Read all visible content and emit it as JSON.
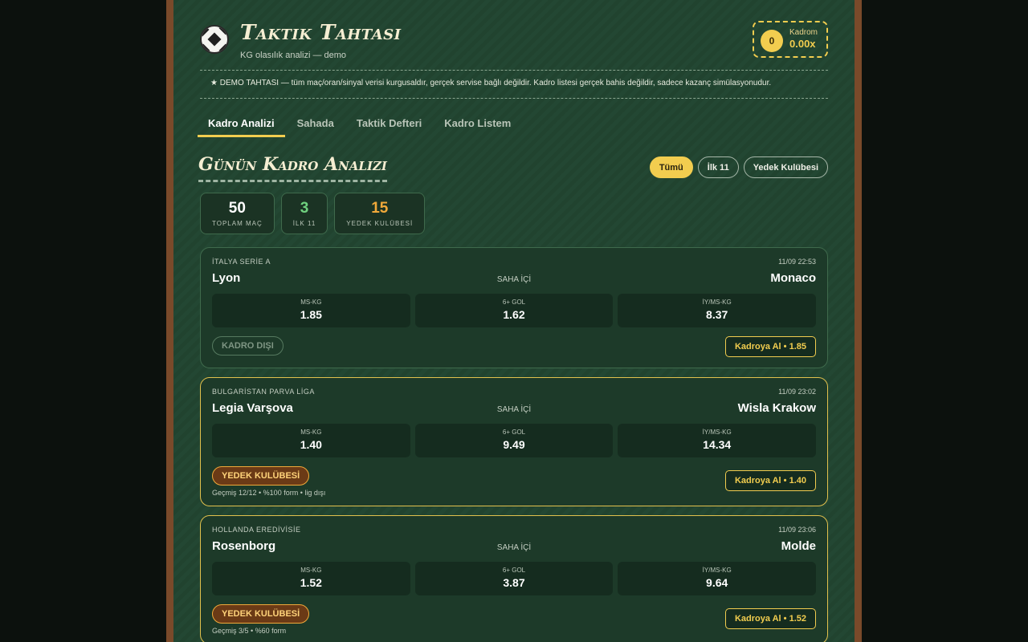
{
  "app": {
    "title": "Taktik Tahtası",
    "subtitle": "KG olasılık analizi — demo"
  },
  "wallet": {
    "count": "0",
    "label": "Kadrom",
    "value": "0.00x"
  },
  "demo_note": "★ DEMO TAHTASI — tüm maç/oran/sinyal verisi kurgusaldır, gerçek servise bağlı değildir. Kadro listesi gerçek bahis değildir, sadece kazanç simülasyonudur.",
  "tabs": [
    {
      "label": "Kadro Analizi",
      "active": true
    },
    {
      "label": "Sahada",
      "active": false
    },
    {
      "label": "Taktik Defteri",
      "active": false
    },
    {
      "label": "Kadro Listem",
      "active": false
    }
  ],
  "section": {
    "title": "Günün Kadro Analizi"
  },
  "filters": [
    {
      "label": "Tümü",
      "active": true
    },
    {
      "label": "İlk 11",
      "active": false
    },
    {
      "label": "Yedek Kulübesi",
      "active": false
    }
  ],
  "stats": [
    {
      "value": "50",
      "label": "TOPLAM MAÇ",
      "color": "#ffffff"
    },
    {
      "value": "3",
      "label": "İLK 11",
      "color": "#6fd17f"
    },
    {
      "value": "15",
      "label": "YEDEK KULÜBESİ",
      "color": "#f0a93a"
    }
  ],
  "colors": {
    "accent": "#f2cd4f",
    "board": "#21432f",
    "frame": "#7a4a2a"
  },
  "matches": [
    {
      "league": "İTALYA SERİE A",
      "time": "11/09 22:53",
      "home": "Lyon",
      "away": "Monaco",
      "status": "SAHA İÇİ",
      "odds": [
        {
          "label": "MS-KG",
          "value": "1.85"
        },
        {
          "label": "6+ GOL",
          "value": "1.62"
        },
        {
          "label": "İY/MS-KG",
          "value": "8.37"
        }
      ],
      "badge": "KADRO DIŞI",
      "badge_type": "out",
      "form": "",
      "add_label": "Kadroya Al • 1.85"
    },
    {
      "league": "BULGARİSTAN PARVA LİGA",
      "time": "11/09 23:02",
      "home": "Legia Varşova",
      "away": "Wisla Krakow",
      "status": "SAHA İÇİ",
      "odds": [
        {
          "label": "MS-KG",
          "value": "1.40"
        },
        {
          "label": "6+ GOL",
          "value": "9.49"
        },
        {
          "label": "İY/MS-KG",
          "value": "14.34"
        }
      ],
      "badge": "YEDEK KULÜBESİ",
      "badge_type": "bench",
      "form": "Geçmiş 12/12 • %100 form • lig dışı",
      "add_label": "Kadroya Al • 1.40"
    },
    {
      "league": "HOLLANDA EREDİVİSİE",
      "time": "11/09 23:06",
      "home": "Rosenborg",
      "away": "Molde",
      "status": "SAHA İÇİ",
      "odds": [
        {
          "label": "MS-KG",
          "value": "1.52"
        },
        {
          "label": "6+ GOL",
          "value": "3.87"
        },
        {
          "label": "İY/MS-KG",
          "value": "9.64"
        }
      ],
      "badge": "YEDEK KULÜBESİ",
      "badge_type": "bench",
      "form": "Geçmiş 3/5 • %60 form",
      "add_label": "Kadroya Al • 1.52"
    }
  ]
}
